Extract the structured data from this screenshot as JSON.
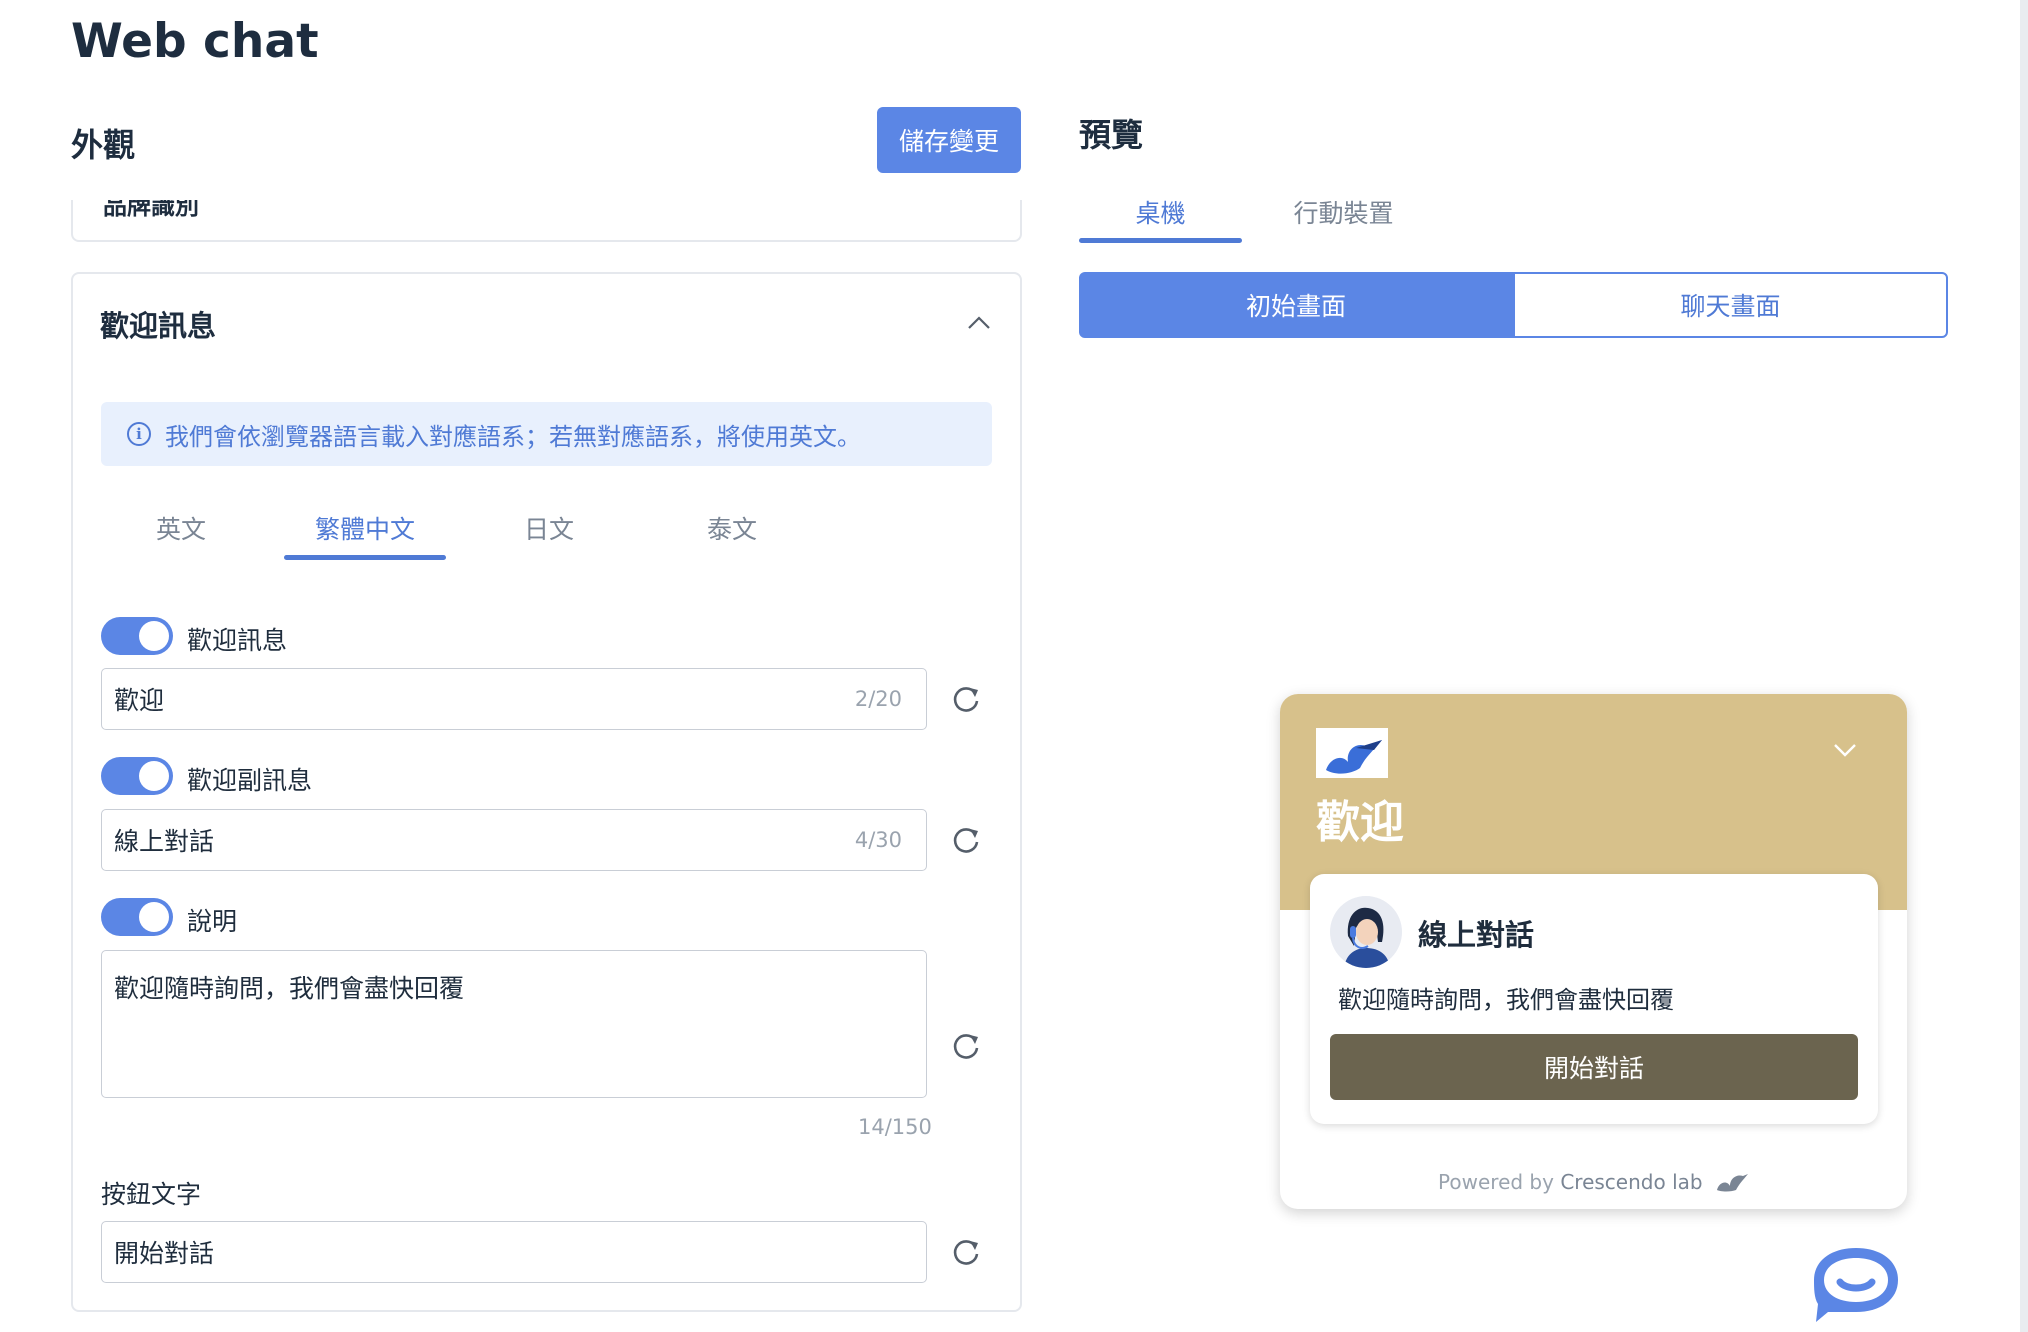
{
  "page": {
    "title": "Web chat"
  },
  "appearance": {
    "title": "外觀",
    "save_label": "儲存變更",
    "prev_section_cut": "品牌識別",
    "welcome_section": {
      "title": "歡迎訊息",
      "info": "我們會依瀏覽器語言載入對應語系；若無對應語系，將使用英文。",
      "lang_tabs": [
        {
          "label": "英文",
          "active": false
        },
        {
          "label": "繁體中文",
          "active": true
        },
        {
          "label": "日文",
          "active": false
        },
        {
          "label": "泰文",
          "active": false
        }
      ],
      "welcome": {
        "label": "歡迎訊息",
        "enabled": true,
        "value": "歡迎",
        "count": "2/20"
      },
      "subtitle": {
        "label": "歡迎副訊息",
        "enabled": true,
        "value": "線上對話",
        "count": "4/30"
      },
      "description": {
        "label": "說明",
        "enabled": true,
        "value": "歡迎隨時詢問，我們會盡快回覆",
        "count": "14/150"
      },
      "button_text": {
        "label": "按鈕文字",
        "value": "開始對話"
      }
    }
  },
  "preview": {
    "title": "預覽",
    "device_tabs": [
      {
        "label": "桌機",
        "active": true
      },
      {
        "label": "行動裝置",
        "active": false
      }
    ],
    "screen_toggle": [
      {
        "label": "初始畫面",
        "active": true
      },
      {
        "label": "聊天畫面",
        "active": false
      }
    ],
    "widget": {
      "title": "歡迎",
      "subtitle": "線上對話",
      "description": "歡迎隨時詢問，我們會盡快回覆",
      "start_button": "開始對話",
      "powered_prefix": "Powered by",
      "powered_brand": "Crescendo lab",
      "header_color": "#d7c18b",
      "button_color": "#6b644f"
    }
  },
  "colors": {
    "accent": "#5b86e5",
    "info_bg": "#e8f0fd",
    "title": "#1e2d3f"
  }
}
